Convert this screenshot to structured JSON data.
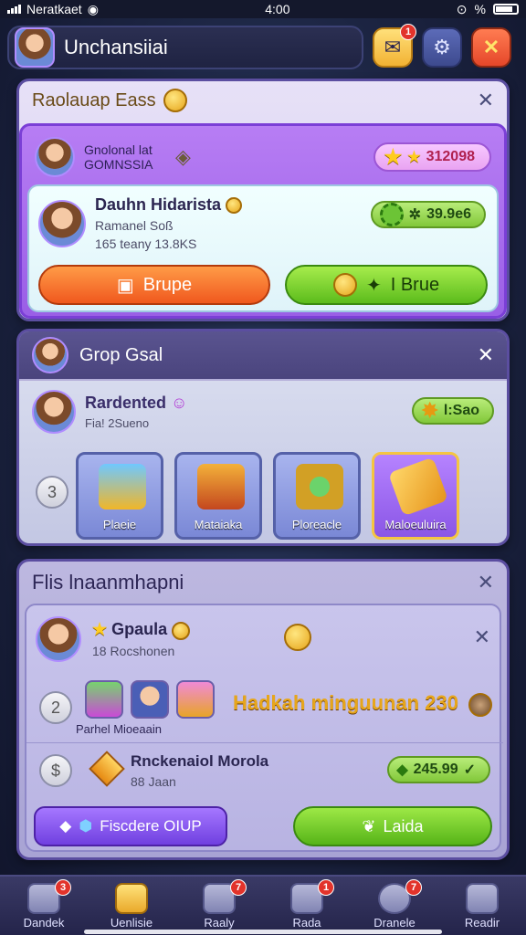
{
  "status_bar": {
    "carrier": "Neratkaet",
    "time": "4:00"
  },
  "header": {
    "title": "Unchansiiai",
    "notif_badge": "1"
  },
  "panel1": {
    "title": "Raolauap Eass",
    "commission_label": "Gnolonal lat GOMNSSIA",
    "pill_value": "312098",
    "card": {
      "name": "Dauhn Hidarista",
      "sub1": "Ramanel Soß",
      "sub2": "165 teany 13.8KS",
      "value": "39.9e6"
    },
    "btn_left": "Brupe",
    "btn_right": "I Brue"
  },
  "panel2": {
    "title": "Grop Gsal",
    "user_name": "Rardented",
    "user_sub": "Fia! 2Sueno",
    "pill_value": "l:Sao",
    "side_number": "3",
    "tiles": [
      {
        "label": "Plaeie"
      },
      {
        "label": "Mataiaka"
      },
      {
        "label": "Ploreacle"
      },
      {
        "label": "Maloeuluira"
      }
    ]
  },
  "panel3": {
    "title": "Flis lnaanmhapni",
    "row1": {
      "title": "Gpaula",
      "sub": "18 Rocshonen"
    },
    "row2": {
      "number": "2",
      "caption": "Parhel Mioeaain",
      "headline": "Hadkah minguunan 230"
    },
    "row3": {
      "number": "$",
      "name": "Rnckenaiol Morola",
      "sub": "88 Jaan",
      "value": "245.99"
    },
    "btn_left": "Fiscdere OIUP",
    "btn_right": "Laida"
  },
  "bottom_nav": [
    {
      "label": "Dandek",
      "badge": "3"
    },
    {
      "label": "Uenlisie",
      "badge": ""
    },
    {
      "label": "Raaly",
      "badge": "7"
    },
    {
      "label": "Rada",
      "badge": "1"
    },
    {
      "label": "Dranele",
      "badge": "7"
    },
    {
      "label": "Readir",
      "badge": ""
    }
  ],
  "colors": {
    "accent_purple": "#9a5fe6",
    "accent_green": "#5cbc1c",
    "accent_orange": "#f0581e"
  }
}
